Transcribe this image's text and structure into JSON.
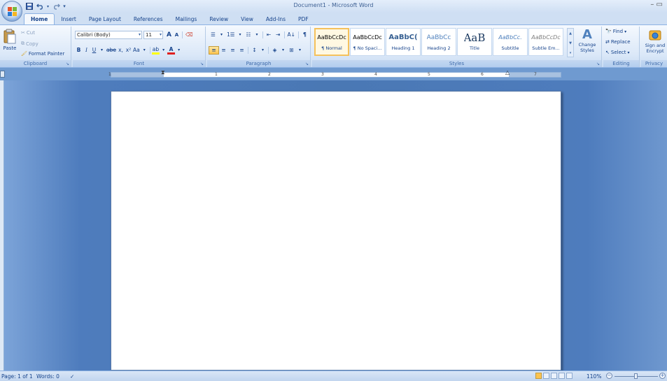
{
  "window": {
    "title": "Document1 - Microsoft Word",
    "controls": "– ▭"
  },
  "quick_access": [
    {
      "name": "save-icon",
      "glyph": "💾"
    },
    {
      "name": "undo-icon",
      "glyph": "↶"
    },
    {
      "name": "redo-icon",
      "glyph": "↷"
    },
    {
      "name": "customize-qat-icon",
      "glyph": "▾"
    }
  ],
  "tabs": [
    "Home",
    "Insert",
    "Page Layout",
    "References",
    "Mailings",
    "Review",
    "View",
    "Add-Ins",
    "PDF"
  ],
  "ribbon": {
    "clipboard": {
      "label": "Clipboard",
      "paste": "Paste",
      "cut": "Cut",
      "copy": "Copy",
      "format_painter": "Format Painter"
    },
    "font": {
      "label": "Font",
      "font_name": "Calibri (Body)",
      "font_size": "11",
      "grow": "A",
      "shrink": "A",
      "clear": "⌫",
      "bold": "B",
      "italic": "I",
      "underline": "U",
      "strike": "abe",
      "subscript": "x,",
      "superscript": "x²",
      "change_case": "Aa",
      "highlight": "ab",
      "font_color": "A"
    },
    "paragraph": {
      "label": "Paragraph",
      "bullets": "☰",
      "numbering": "1☰",
      "multilevel": "☷",
      "decrease_indent": "⇤",
      "increase_indent": "⇥",
      "sort": "A↓",
      "show_marks": "¶",
      "align_left": "≡",
      "center": "≡",
      "align_right": "≡",
      "justify": "≡",
      "line_spacing": "↕",
      "shading": "◈",
      "borders": "⊞"
    },
    "styles": {
      "label": "Styles",
      "items": [
        {
          "preview": "AaBbCcDc",
          "label": "¶ Normal"
        },
        {
          "preview": "AaBbCcDc",
          "label": "¶ No Spaci..."
        },
        {
          "preview": "AaBbC(",
          "label": "Heading 1"
        },
        {
          "preview": "AaBbCc",
          "label": "Heading 2"
        },
        {
          "preview": "AaB",
          "label": "Title"
        },
        {
          "preview": "AaBbCc.",
          "label": "Subtitle"
        },
        {
          "preview": "AaBbCcDc",
          "label": "Subtle Em..."
        }
      ],
      "change_styles": "Change Styles"
    },
    "editing": {
      "label": "Editing",
      "find": "Find",
      "replace": "Replace",
      "select": "Select"
    },
    "privacy": {
      "label": "Privacy",
      "sign_encrypt": "Sign and Encrypt"
    }
  },
  "ruler": {
    "numbers": [
      "1",
      "1",
      "2",
      "3",
      "4",
      "5",
      "6",
      "7"
    ]
  },
  "status": {
    "page": "Page: 1 of 1",
    "words": "Words: 0",
    "zoom": "110%",
    "zoom_minus": "−",
    "zoom_plus": "+"
  },
  "colors": {
    "ribbon_text": "#15428b",
    "workspace": "#4a78b4",
    "highlight_color": "#ffff00",
    "font_color": "#e02020"
  }
}
